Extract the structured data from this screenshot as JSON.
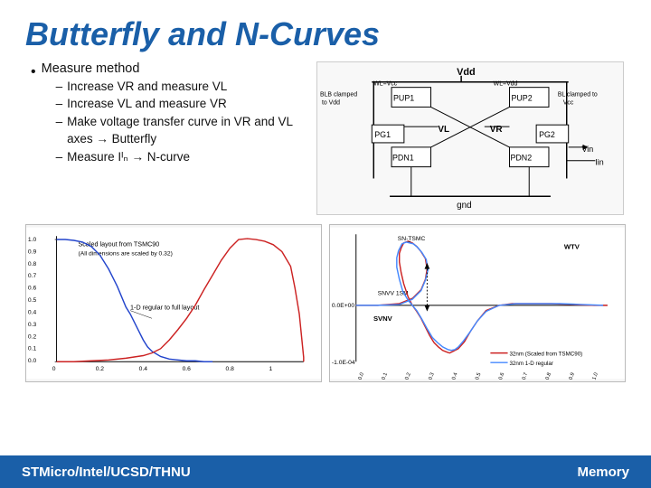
{
  "slide": {
    "title": "Butterfly and N-Curves",
    "measure_method_label": "Measure method",
    "sub_bullets": [
      "Increase VR and measure VL",
      "Increase VL and measure VR",
      "Make voltage transfer curve in VR and VL axes → Butterfly",
      "Measure Iᴵₙ → N-curve"
    ],
    "footer": {
      "left": "STMicro/Intel/UCSD/THNU",
      "right": "Memory"
    },
    "graph_left": {
      "label": "Scaled layout from TSMC90",
      "sublabel": "All dimensions are scaled by 0.32",
      "note": "1-D regular to full layout",
      "y_max": "1.0",
      "y_ticks": [
        "1.0",
        "0.9",
        "0.8",
        "0.7",
        "0.6",
        "0.5",
        "0.4",
        "0.3",
        "0.2",
        "0.1",
        "0.0"
      ],
      "x_ticks": [
        "0",
        "0.2",
        "0.4",
        "0.6",
        "0.8",
        "1"
      ]
    },
    "graph_right": {
      "label1": "32nm (Scaled from TSMC90)",
      "label2": "32nm 1-D regular",
      "y_label": "WTV",
      "x_label": "SVNV",
      "y_min": "-1.0E-04"
    }
  }
}
